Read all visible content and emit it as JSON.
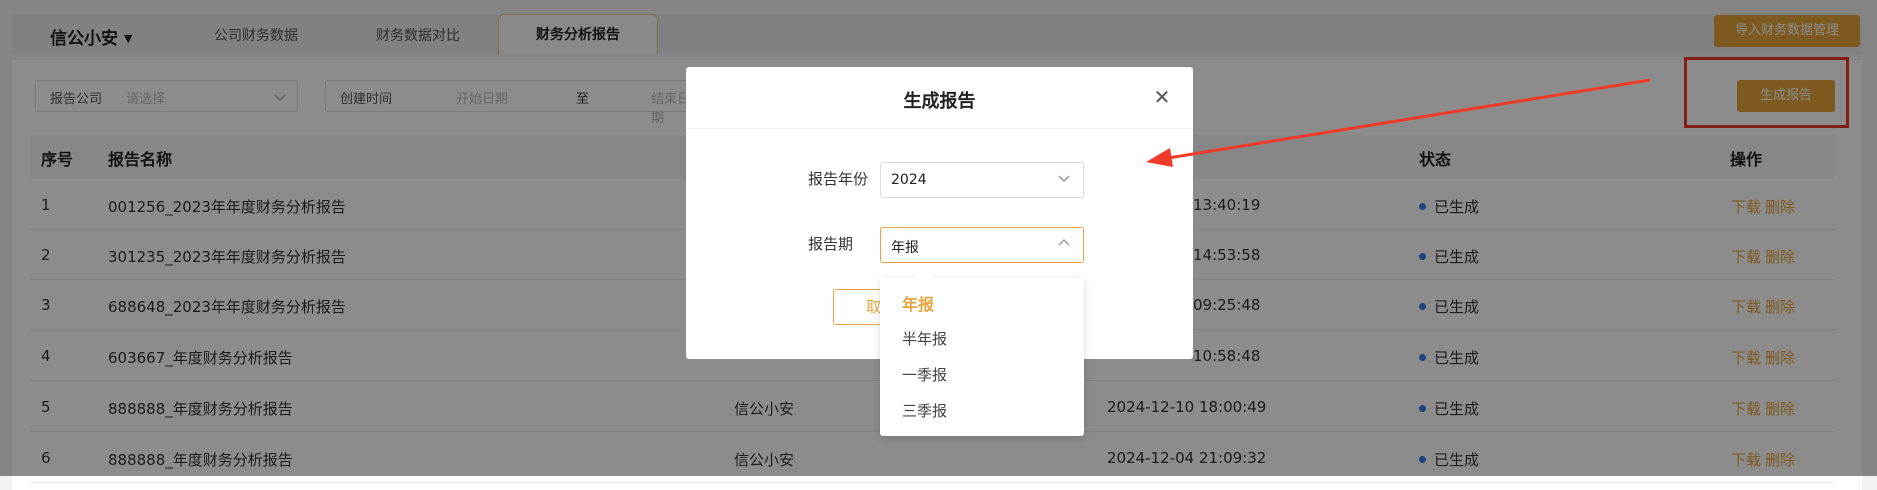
{
  "header": {
    "company": "信公小安",
    "tabs": [
      "公司财务数据",
      "财务数据对比",
      "财务分析报告"
    ],
    "active_tab": "财务分析报告",
    "import_button": "导入财务数据管理"
  },
  "filters": {
    "company_label": "报告公司",
    "company_placeholder": "请选择",
    "created_label": "创建时间",
    "start_placeholder": "开始日期",
    "to": "至",
    "end_placeholder": "结束日期"
  },
  "generate_button": "生成报告",
  "table": {
    "headers": {
      "index": "序号",
      "name": "报告名称",
      "status": "状态",
      "ops": "操作"
    },
    "rows": [
      {
        "index": "1",
        "name": "001256_2023年年度财务分析报告",
        "creator": "",
        "time": "13:40:19",
        "status": "已生成"
      },
      {
        "index": "2",
        "name": "301235_2023年年度财务分析报告",
        "creator": "",
        "time": "14:53:58",
        "status": "已生成"
      },
      {
        "index": "3",
        "name": "688648_2023年年度财务分析报告",
        "creator": "",
        "time": "09:25:48",
        "status": "已生成"
      },
      {
        "index": "4",
        "name": "603667_年度财务分析报告",
        "creator": "",
        "time": "10:58:48",
        "status": "已生成"
      },
      {
        "index": "5",
        "name": "888888_年度财务分析报告",
        "creator": "信公小安",
        "time": "2024-12-10 18:00:49",
        "status": "已生成"
      },
      {
        "index": "6",
        "name": "888888_年度财务分析报告",
        "creator": "信公小安",
        "time": "2024-12-04 21:09:32",
        "status": "已生成"
      }
    ],
    "op_download": "下载",
    "op_delete": "删除"
  },
  "dialog": {
    "title": "生成报告",
    "year_label": "报告年份",
    "year_value": "2024",
    "period_label": "报告期",
    "period_value": "年报",
    "cancel_label": "取消",
    "period_options": [
      "年报",
      "半年报",
      "一季报",
      "三季报"
    ]
  },
  "colors": {
    "accent": "#e5a43d",
    "annotation": "#f03a2a",
    "status_dot": "#3b78e7"
  }
}
